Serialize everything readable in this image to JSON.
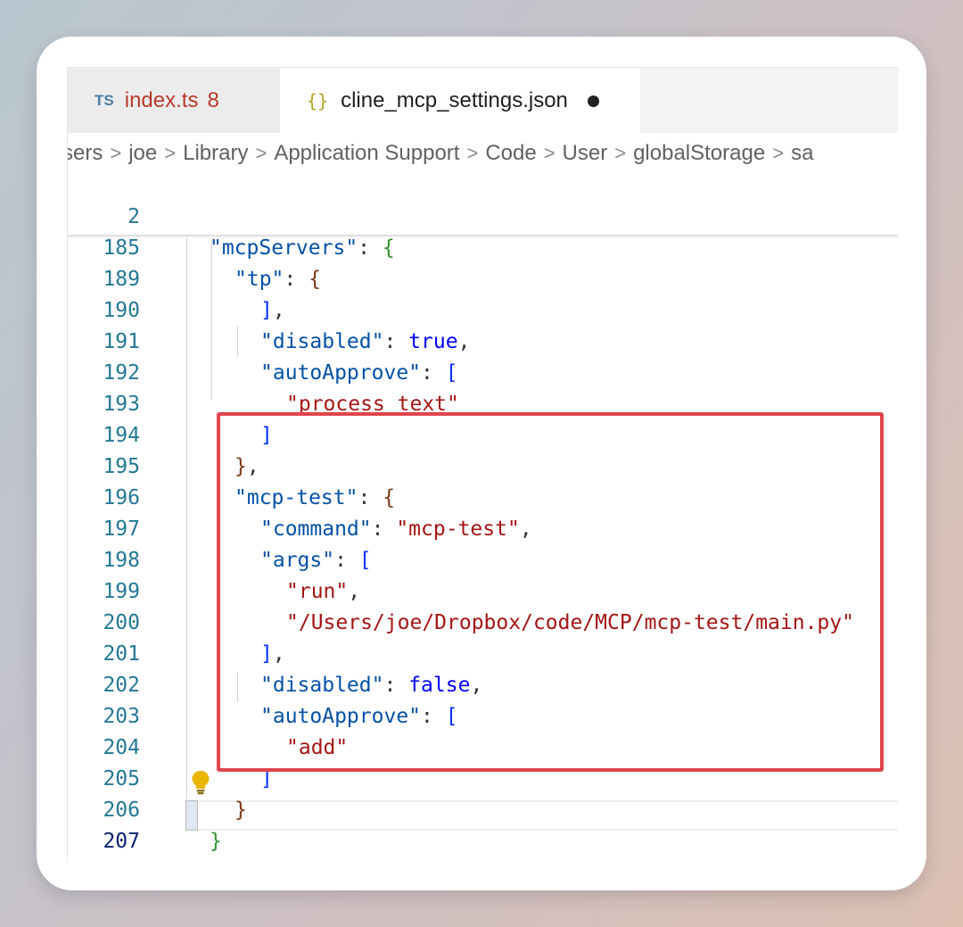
{
  "tabs": [
    {
      "icon": "TS",
      "label": "index.ts",
      "count": "8"
    },
    {
      "icon": "{}",
      "label": "cline_mcp_settings.json"
    }
  ],
  "breadcrumb": [
    "sers",
    "joe",
    "Library",
    "Application Support",
    "Code",
    "User",
    "globalStorage",
    "sa"
  ],
  "breadcrumb_separator": ">",
  "lines": [
    {
      "n": "2",
      "text": "\"mcpServers\": {"
    },
    {
      "n": "185",
      "text": "\"tp\": {"
    },
    {
      "n": "189",
      "text": "],"
    },
    {
      "n": "190",
      "text": "\"disabled\": true,"
    },
    {
      "n": "191",
      "text": "\"autoApprove\": ["
    },
    {
      "n": "192",
      "text": "\"process_text\""
    },
    {
      "n": "193",
      "text": "]"
    },
    {
      "n": "194",
      "text": "},"
    },
    {
      "n": "195",
      "text": "\"mcp-test\": {"
    },
    {
      "n": "196",
      "text": "\"command\": \"mcp-test\","
    },
    {
      "n": "197",
      "text": "\"args\": ["
    },
    {
      "n": "198",
      "text": "\"run\","
    },
    {
      "n": "199",
      "text": "\"/Users/joe/Dropbox/code/MCP/mcp-test/main.py\""
    },
    {
      "n": "200",
      "text": "],"
    },
    {
      "n": "201",
      "text": "\"disabled\": false,"
    },
    {
      "n": "202",
      "text": "\"autoApprove\": ["
    },
    {
      "n": "203",
      "text": "\"add\""
    },
    {
      "n": "204",
      "text": "]"
    },
    {
      "n": "205",
      "text": "}"
    },
    {
      "n": "206",
      "text": "}"
    },
    {
      "n": "207",
      "text": "}"
    }
  ],
  "tokens": {
    "mcpServers": "\"mcpServers\"",
    "tp": "\"tp\"",
    "disabled": "\"disabled\"",
    "autoApprove": "\"autoApprove\"",
    "process_text": "\"process_text\"",
    "mcp_test_key": "\"mcp-test\"",
    "command": "\"command\"",
    "mcp_test_val": "\"mcp-test\"",
    "args": "\"args\"",
    "run": "\"run\"",
    "path": "\"/Users/joe/Dropbox/code/MCP/mcp-test/main.py\"",
    "add": "\"add\"",
    "true": "true",
    "false": "false"
  },
  "colors": {
    "highlight_box": "#e0454c",
    "key": "#0451a5",
    "string": "#a31515",
    "keyword": "#0000ff",
    "line_number": "#237893"
  }
}
